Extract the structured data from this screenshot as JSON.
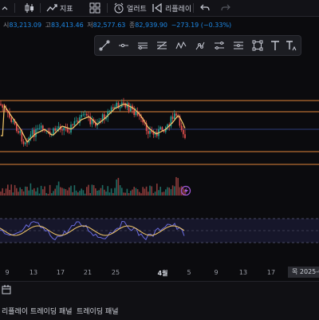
{
  "toolbar": {
    "indicators_label": "지표",
    "alert_label": "얼러트",
    "replay_label": "리플레이"
  },
  "ohlc": {
    "open_label": "시",
    "open": "83,213.09",
    "high_label": "고",
    "high": "83,413.46",
    "low_label": "저",
    "low": "82,577.63",
    "close_label": "종",
    "close": "82,939.90",
    "change": "−273.19 (−0.33%)"
  },
  "drawing_tools": [
    "trend-line-icon",
    "horizontal-ray-icon",
    "parallel-channel-icon",
    "fib-retracement-icon",
    "zigzag-pattern-icon",
    "long-position-icon",
    "date-price-range-icon",
    "rectangle-icon",
    "text-icon",
    "text-note-icon"
  ],
  "x_axis": {
    "labels": [
      "9",
      "13",
      "17",
      "21",
      "25",
      "4월",
      "5",
      "9",
      "13",
      "17"
    ],
    "current_date": "목 2025-0"
  },
  "panels": {
    "replay_trading": "리플레이 트레이딩 패널",
    "trading": "트레이딩 패널"
  },
  "colors": {
    "up": "#26a69a",
    "down": "#ef5350",
    "accent": "#2962ff",
    "level_line": "#e0843a",
    "ma_line": "#f5c96a",
    "osc_line": "#6b6de0",
    "volume_marker": "#a259d9"
  }
}
